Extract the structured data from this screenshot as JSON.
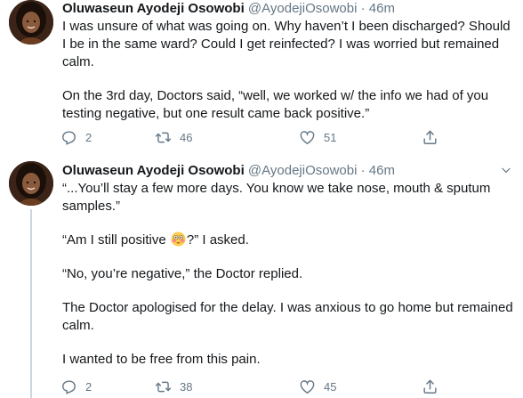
{
  "tweets": [
    {
      "author": {
        "name": "Oluwaseun Ayodeji Osowobi",
        "handle": "@AyodejiOsowobi",
        "separator": "·",
        "time": "46m"
      },
      "paragraphs": [
        "I was unsure of what was going on. Why haven’t I been discharged? Should I be in the same ward? Could I get reinfected? I was worried but remained calm.",
        "On the 3rd day, Doctors said, “well, we worked w/ the info we had of you testing negative, but one result came back positive.”"
      ],
      "counts": {
        "replies": "2",
        "retweets": "46",
        "likes": "51"
      }
    },
    {
      "author": {
        "name": "Oluwaseun Ayodeji Osowobi",
        "handle": "@AyodejiOsowobi",
        "separator": "·",
        "time": "46m"
      },
      "paragraphs": [
        "“...You’ll stay a few more days. You know we take nose, mouth & sputum samples.”",
        {
          "before": "“Am I still positive ",
          "emoji": "flushed-face-emoji",
          "after": "?” I asked."
        },
        "“No, you’re negative,” the Doctor replied.",
        "The Doctor apologised for the delay. I was anxious to go home but remained calm.",
        "I wanted to be free from this pain."
      ],
      "counts": {
        "replies": "2",
        "retweets": "38",
        "likes": "45"
      }
    }
  ],
  "icons": {
    "reply": "reply-icon",
    "retweet": "retweet-icon",
    "like": "heart-icon",
    "share": "share-icon",
    "more": "chevron-down-icon"
  },
  "colors": {
    "text": "#14171a",
    "secondary": "#657786",
    "divider": "#e6ecf0",
    "thread_line": "#ccd6dd"
  }
}
